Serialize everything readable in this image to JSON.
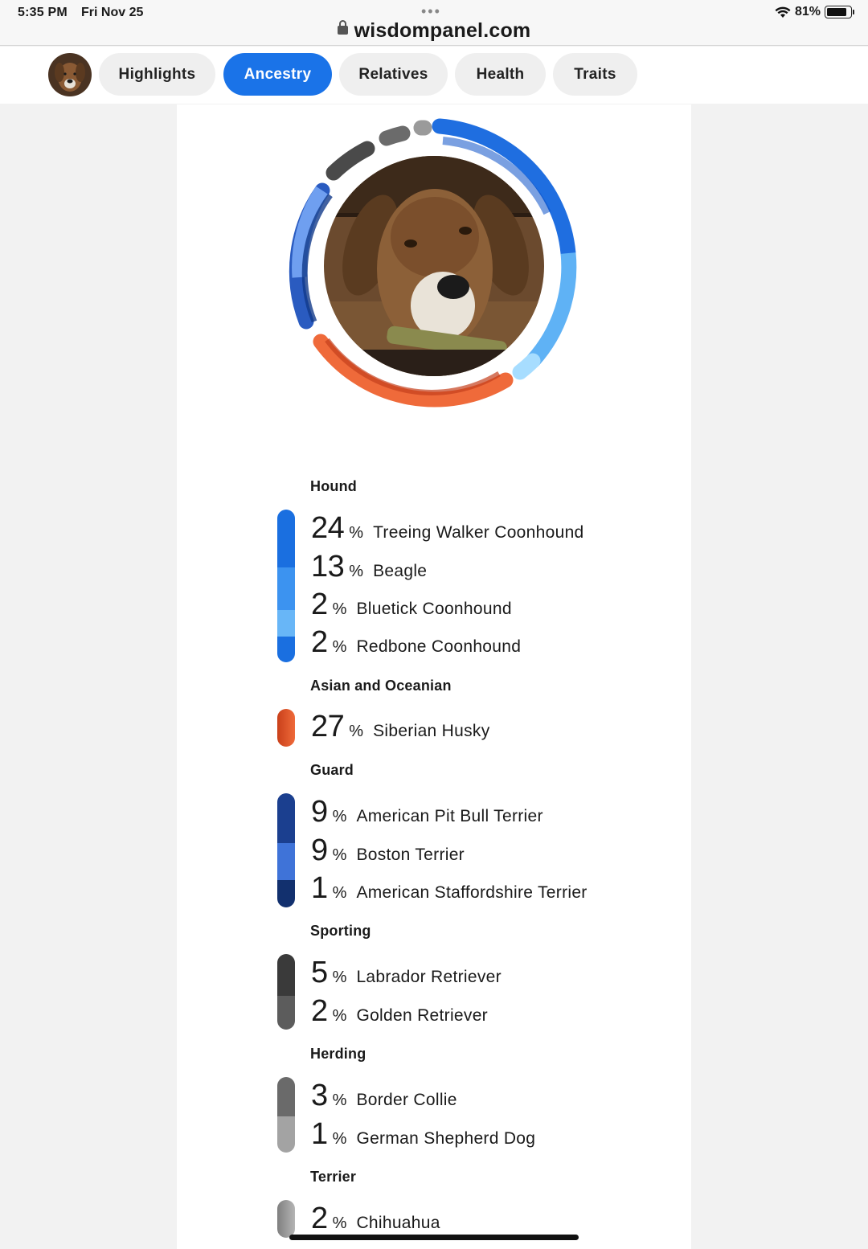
{
  "status": {
    "time": "5:35 PM",
    "date": "Fri Nov 25",
    "battery": "81%",
    "battery_level": 0.81
  },
  "browser": {
    "url": "wisdompanel.com"
  },
  "nav": {
    "tabs": [
      {
        "label": "Highlights",
        "active": false
      },
      {
        "label": "Ancestry",
        "active": true
      },
      {
        "label": "Relatives",
        "active": false
      },
      {
        "label": "Health",
        "active": false
      },
      {
        "label": "Traits",
        "active": false
      }
    ]
  },
  "colors": {
    "accent": "#1a73e8",
    "hound": "#1f7ae6",
    "asian": "#e2542a",
    "guard": "#1b3f8f",
    "sporting": "#4a4a4a",
    "herding": "#7a7a7a",
    "terrier": "#999999"
  },
  "groups": [
    {
      "title": "Hound",
      "breeds": [
        {
          "pct": "24",
          "name": "Treeing Walker Coonhound"
        },
        {
          "pct": "13",
          "name": "Beagle"
        },
        {
          "pct": "2",
          "name": "Bluetick Coonhound"
        },
        {
          "pct": "2",
          "name": "Redbone Coonhound"
        }
      ]
    },
    {
      "title": "Asian and Oceanian",
      "breeds": [
        {
          "pct": "27",
          "name": "Siberian Husky"
        }
      ]
    },
    {
      "title": "Guard",
      "breeds": [
        {
          "pct": "9",
          "name": "American Pit Bull Terrier"
        },
        {
          "pct": "9",
          "name": "Boston Terrier"
        },
        {
          "pct": "1",
          "name": "American Staffordshire Terrier"
        }
      ]
    },
    {
      "title": "Sporting",
      "breeds": [
        {
          "pct": "5",
          "name": "Labrador Retriever"
        },
        {
          "pct": "2",
          "name": "Golden Retriever"
        }
      ]
    },
    {
      "title": "Herding",
      "breeds": [
        {
          "pct": "3",
          "name": "Border Collie"
        },
        {
          "pct": "1",
          "name": "German Shepherd Dog"
        }
      ]
    },
    {
      "title": "Terrier",
      "breeds": [
        {
          "pct": "2",
          "name": "Chihuahua"
        }
      ]
    }
  ],
  "pct_symbol": "%"
}
